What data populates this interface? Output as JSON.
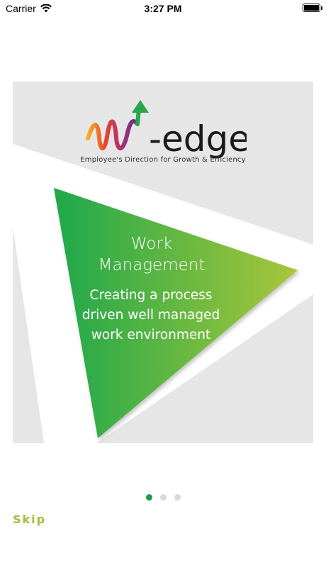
{
  "status_bar": {
    "carrier": "Carrier",
    "time": "3:27 PM"
  },
  "slide": {
    "logo": {
      "wordmark_suffix": "-edge",
      "tagline": "Employee's Direction for Growth & Efficiency"
    },
    "title_line1": "Work",
    "title_line2": "Management",
    "description": "Creating a process driven well managed work environment"
  },
  "pager": {
    "total": 3,
    "active_index": 0
  },
  "skip_label": "Skip",
  "colors": {
    "green_dark": "#1ea84a",
    "green_light": "#a9c63a",
    "skip": "#9fc03a",
    "dot_active": "#1f9a4a",
    "dot_inactive": "#d9d9d9"
  }
}
